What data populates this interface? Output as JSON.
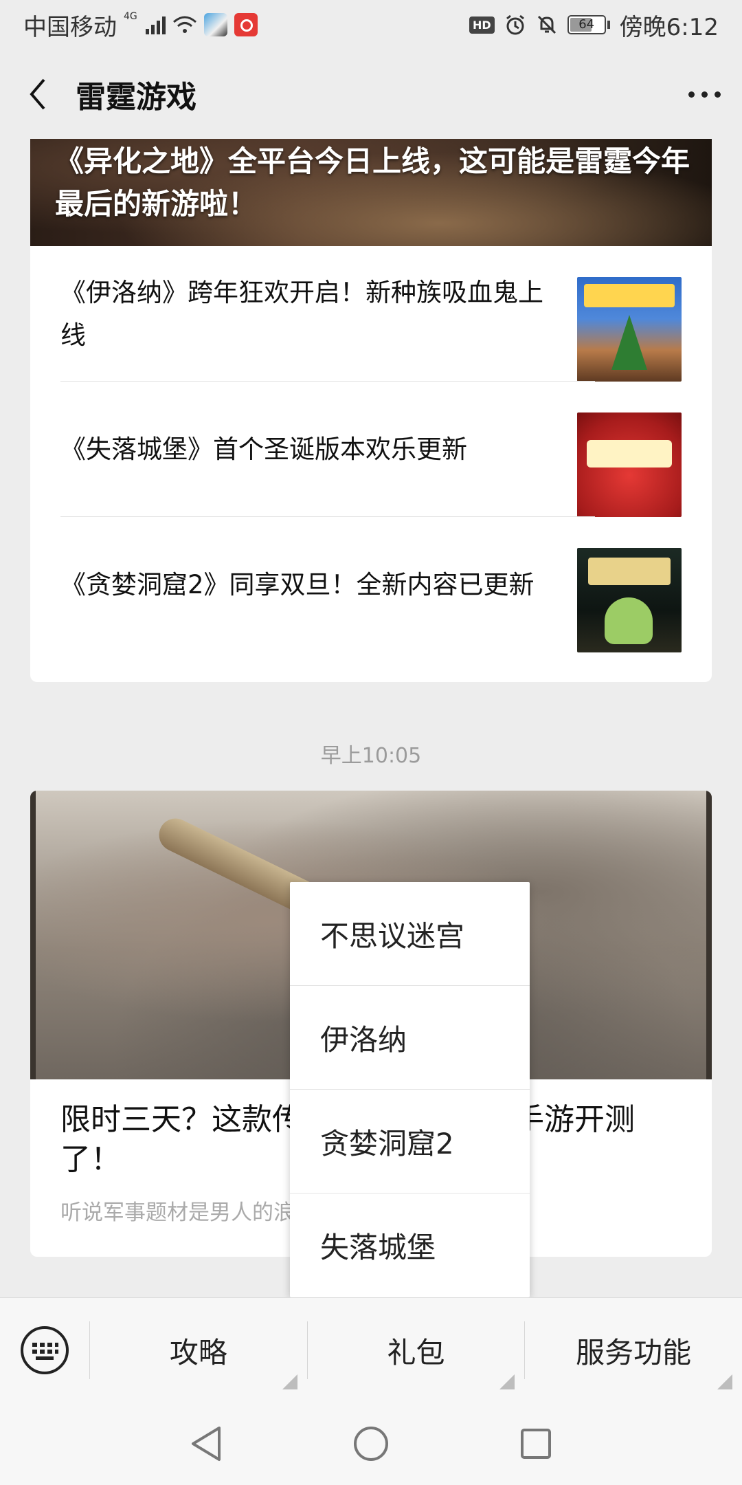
{
  "status_bar": {
    "carrier": "中国移动",
    "network": "4G",
    "battery": "64",
    "time": "傍晚6:12",
    "hd": "HD"
  },
  "header": {
    "title": "雷霆游戏"
  },
  "article_group_1": {
    "hero_title": "《异化之地》全平台今日上线，这可能是雷霆今年最后的新游啦！",
    "items": [
      {
        "title": "《伊洛纳》跨年狂欢开启！新种族吸血鬼上线"
      },
      {
        "title": "《失落城堡》首个圣诞版本欢乐更新"
      },
      {
        "title": "《贪婪洞窟2》同享双旦！全新内容已更新"
      }
    ]
  },
  "timestamp": "早上10:05",
  "article_2": {
    "title": "限时三天？这款传说中的军事战棋手游开测了！",
    "description": "听说军事题材是男人的浪漫"
  },
  "popup_menu": {
    "items": [
      {
        "label": "不思议迷宫"
      },
      {
        "label": "伊洛纳"
      },
      {
        "label": "贪婪洞窟2"
      },
      {
        "label": "失落城堡"
      }
    ]
  },
  "bottom_menu": {
    "tabs": [
      {
        "label": "攻略"
      },
      {
        "label": "礼包"
      },
      {
        "label": "服务功能"
      }
    ]
  }
}
